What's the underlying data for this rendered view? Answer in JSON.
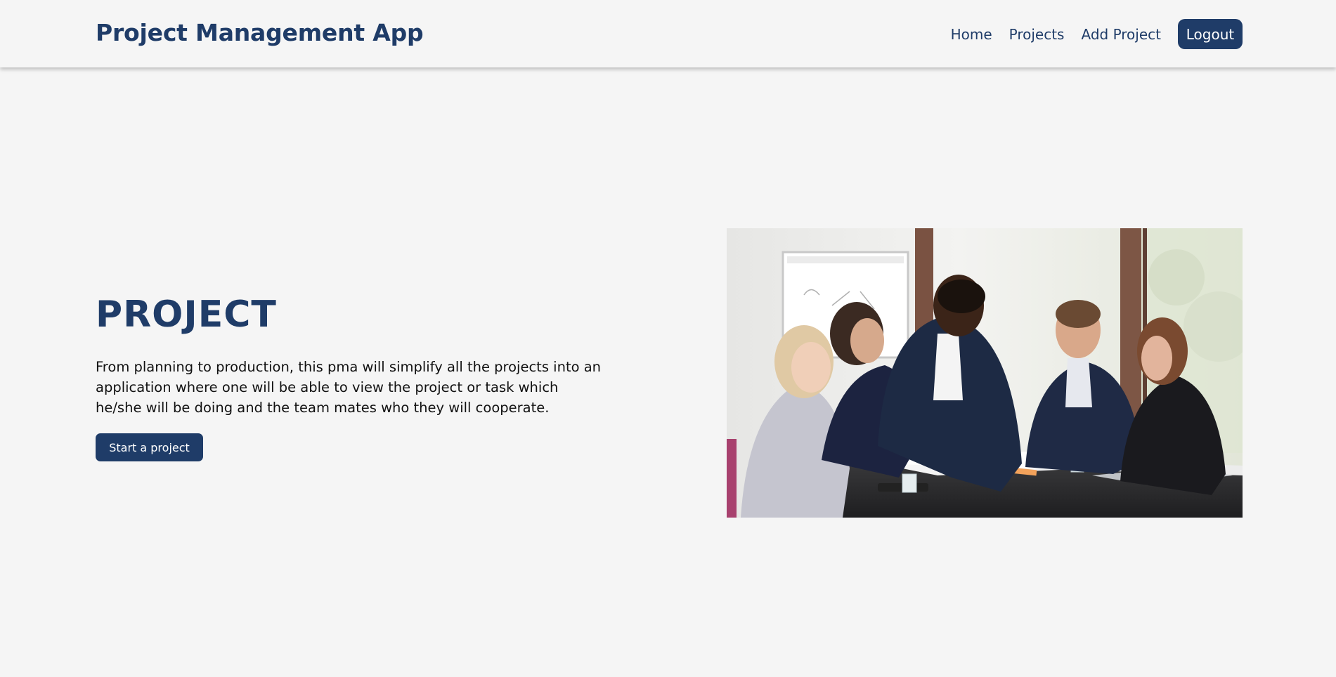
{
  "navbar": {
    "brand": "Project Management App",
    "links": [
      "Home",
      "Projects",
      "Add Project"
    ],
    "logout_label": "Logout"
  },
  "hero": {
    "title": "PROJECT",
    "description": "From planning to production, this pma will simplify all the projects into an application where one will be able to view the project or task which he/she will be doing and the team mates who they will cooperate.",
    "cta_label": "Start a project"
  },
  "colors": {
    "brand": "#1f3c68",
    "background": "#f5f5f5",
    "text": "#111111"
  },
  "icons": {
    "hero_image": "team-meeting-photo"
  }
}
